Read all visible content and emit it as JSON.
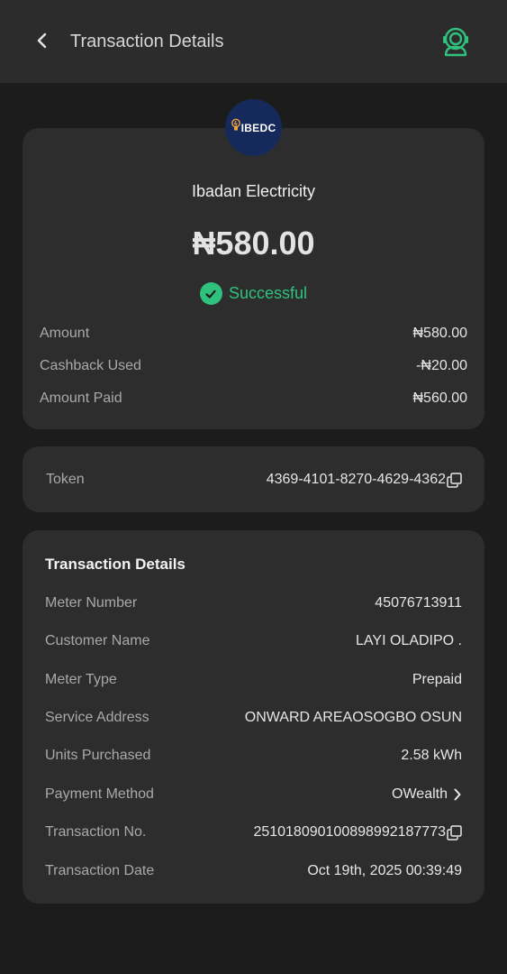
{
  "header": {
    "title": "Transaction Details",
    "back_icon": "chevron-left-icon",
    "support_icon": "customer-support-icon"
  },
  "colors": {
    "accent_green": "#2ec27e",
    "logo_bg": "#152a5b",
    "card_bg": "#2d2d2d",
    "page_bg": "#1c1c1c"
  },
  "summary": {
    "logo_text": "IBEDC",
    "biller_name": "Ibadan Electricity",
    "amount": "₦580.00",
    "status": "Successful",
    "rows": [
      {
        "label": "Amount",
        "value": "₦580.00"
      },
      {
        "label": "Cashback Used",
        "value": "-₦20.00"
      },
      {
        "label": "Amount Paid",
        "value": "₦560.00"
      }
    ]
  },
  "token": {
    "label": "Token",
    "value": "4369-4101-8270-4629-4362"
  },
  "details": {
    "title": "Transaction Details",
    "rows": [
      {
        "label": "Meter Number",
        "value": "45076713911"
      },
      {
        "label": "Customer Name",
        "value": "LAYI OLADIPO ."
      },
      {
        "label": "Meter Type",
        "value": "Prepaid"
      },
      {
        "label": "Service Address",
        "value": "ONWARD AREAOSOGBO OSUN"
      },
      {
        "label": "Units Purchased",
        "value": "2.58 kWh"
      },
      {
        "label": "Payment Method",
        "value": "OWealth"
      },
      {
        "label": "Transaction No.",
        "value": "251018090100898992187773"
      },
      {
        "label": "Transaction Date",
        "value": "Oct 19th, 2025 00:39:49"
      }
    ]
  }
}
